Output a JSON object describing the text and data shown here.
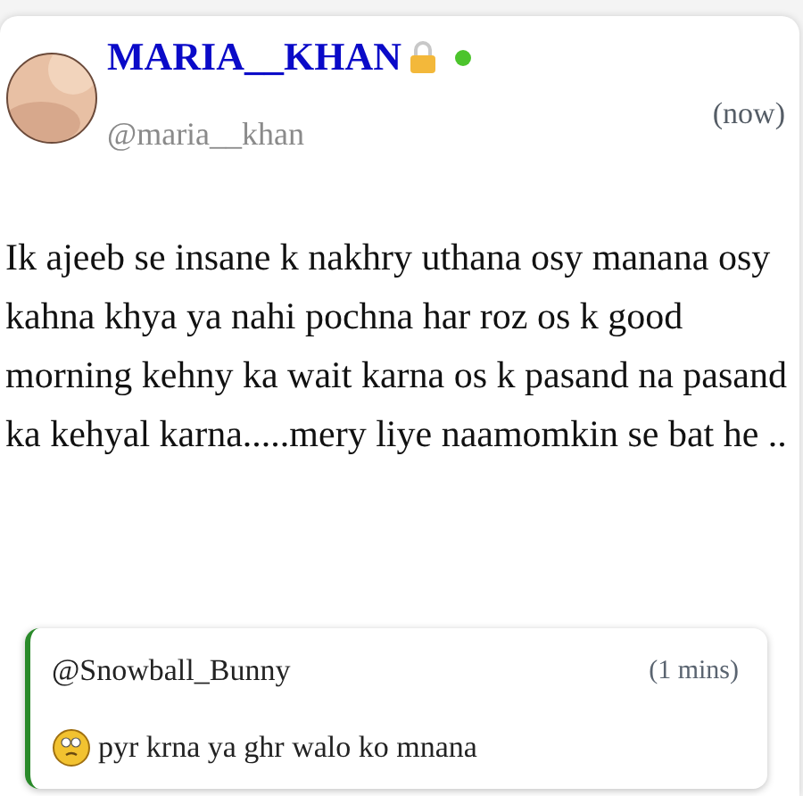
{
  "post": {
    "author": {
      "name": "MARIA__KHAN",
      "handle": "@maria__khan",
      "locked": true,
      "online": true
    },
    "time": "(now)",
    "text": "Ik ajeeb se insane k nakhry uthana osy manana osy kahna khya ya nahi pochna har roz os k good morning kehny ka wait karna os k pasand na pasand ka kehyal karna.....mery liye naamomkin se bat he ..",
    "reply": {
      "handle": "@Snowball_Bunny",
      "time": "(1 mins)",
      "text": "pyr krna ya ghr walo ko mnana"
    }
  }
}
